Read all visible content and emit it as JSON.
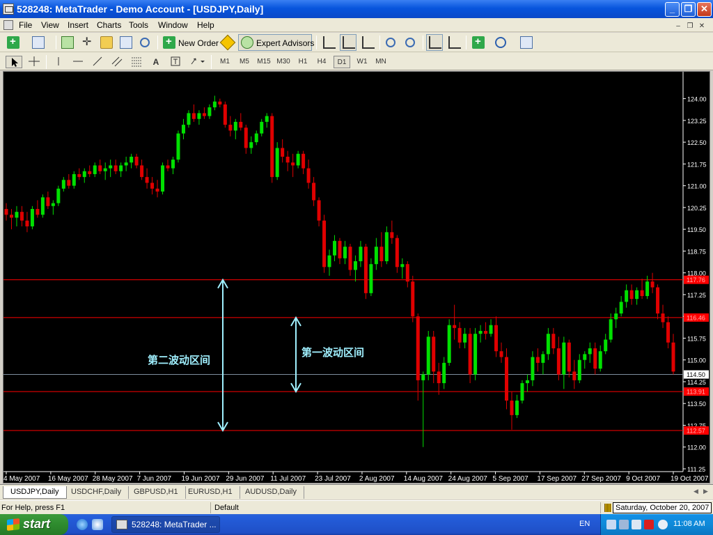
{
  "window": {
    "title": "528248: MetaTrader - Demo Account - [USDJPY,Daily]",
    "controls": [
      "_",
      "❐",
      "✕"
    ]
  },
  "menu": {
    "items": [
      "File",
      "View",
      "Insert",
      "Charts",
      "Tools",
      "Window",
      "Help"
    ],
    "mdi_controls": [
      "–",
      "❐",
      "✕"
    ]
  },
  "toolbar": {
    "new_order_label": "New Order",
    "expert_advisors_label": "Expert Advisors",
    "timeframes": [
      "M1",
      "M5",
      "M15",
      "M30",
      "H1",
      "H4",
      "D1",
      "W1",
      "MN"
    ],
    "active_timeframe": "D1",
    "text_tool_label": "A"
  },
  "chart_data": {
    "type": "candlestick",
    "symbol": "USDJPY",
    "period": "Daily",
    "price_axis": {
      "min": 111.25,
      "max": 124.0,
      "ticks": [
        "124.00",
        "123.25",
        "122.50",
        "121.75",
        "121.00",
        "120.25",
        "119.50",
        "118.75",
        "118.00",
        "117.25",
        "116.50",
        "115.75",
        "115.00",
        "114.25",
        "113.50",
        "112.75",
        "112.00",
        "111.25"
      ],
      "current_price": "114.50"
    },
    "x_labels": [
      "4 May 2007",
      "16 May 2007",
      "28 May 2007",
      "7 Jun 2007",
      "19 Jun 2007",
      "29 Jun 2007",
      "11 Jul 2007",
      "23 Jul 2007",
      "2 Aug 2007",
      "14 Aug 2007",
      "24 Aug 2007",
      "5 Sep 2007",
      "17 Sep 2007",
      "27 Sep 2007",
      "9 Oct 2007",
      "19 Oct 2007"
    ],
    "horizontal_lines": [
      {
        "price": 117.76,
        "label": "117.76",
        "color": "#ff0000"
      },
      {
        "price": 116.46,
        "label": "116.46",
        "color": "#ff0000"
      },
      {
        "price": 113.91,
        "label": "113.91",
        "color": "#ff0000"
      },
      {
        "price": 112.57,
        "label": "112.57",
        "color": "#ff0000"
      },
      {
        "price": 114.5,
        "label": "114.50",
        "color": "#7f8f9f"
      }
    ],
    "annotations": [
      {
        "text": "第二波动区间",
        "arrow_from": 117.76,
        "arrow_to": 112.57
      },
      {
        "text": "第一波动区间",
        "arrow_from": 116.46,
        "arrow_to": 113.91
      }
    ],
    "colors": {
      "background": "#000000",
      "bull": "#00e000",
      "bear": "#e00000",
      "axis_text": "#ffffff",
      "annotation": "#a0f0ff"
    },
    "candles": [
      [
        120.2,
        120.4,
        119.8,
        120.0
      ],
      [
        120.0,
        120.2,
        119.5,
        119.9
      ],
      [
        119.9,
        120.3,
        119.6,
        120.1
      ],
      [
        120.1,
        120.3,
        119.6,
        119.8
      ],
      [
        119.8,
        120.1,
        119.4,
        119.6
      ],
      [
        119.6,
        120.3,
        119.5,
        120.2
      ],
      [
        120.2,
        120.5,
        119.9,
        120.0
      ],
      [
        120.0,
        120.7,
        119.9,
        120.6
      ],
      [
        120.6,
        120.8,
        120.2,
        120.3
      ],
      [
        120.3,
        120.5,
        120.0,
        120.4
      ],
      [
        120.4,
        121.0,
        120.3,
        120.9
      ],
      [
        120.9,
        121.3,
        120.8,
        121.2
      ],
      [
        121.2,
        121.4,
        120.9,
        121.0
      ],
      [
        121.0,
        121.5,
        120.9,
        121.4
      ],
      [
        121.4,
        121.6,
        121.2,
        121.3
      ],
      [
        121.3,
        121.6,
        121.1,
        121.5
      ],
      [
        121.5,
        121.7,
        121.3,
        121.4
      ],
      [
        121.4,
        121.8,
        121.3,
        121.7
      ],
      [
        121.7,
        121.9,
        121.4,
        121.5
      ],
      [
        121.5,
        121.8,
        121.2,
        121.6
      ],
      [
        121.6,
        121.9,
        121.3,
        121.7
      ],
      [
        121.7,
        121.9,
        121.4,
        121.5
      ],
      [
        121.5,
        121.8,
        121.3,
        121.7
      ],
      [
        121.7,
        122.0,
        121.5,
        121.8
      ],
      [
        121.8,
        122.1,
        121.6,
        122.0
      ],
      [
        122.0,
        122.1,
        121.6,
        121.7
      ],
      [
        121.7,
        121.9,
        121.2,
        121.3
      ],
      [
        121.3,
        121.6,
        120.9,
        121.1
      ],
      [
        121.1,
        121.3,
        120.7,
        120.9
      ],
      [
        120.9,
        121.2,
        120.6,
        120.8
      ],
      [
        120.8,
        121.8,
        120.7,
        121.7
      ],
      [
        121.7,
        121.9,
        121.5,
        121.6
      ],
      [
        121.6,
        122.0,
        121.4,
        121.9
      ],
      [
        121.9,
        122.9,
        121.8,
        122.8
      ],
      [
        122.8,
        123.3,
        122.6,
        123.1
      ],
      [
        123.1,
        123.6,
        123.0,
        123.5
      ],
      [
        123.5,
        123.8,
        123.2,
        123.3
      ],
      [
        123.3,
        123.6,
        123.1,
        123.5
      ],
      [
        123.5,
        123.7,
        123.3,
        123.4
      ],
      [
        123.4,
        123.8,
        123.3,
        123.7
      ],
      [
        123.7,
        124.1,
        123.6,
        123.9
      ],
      [
        123.9,
        124.0,
        123.7,
        123.8
      ],
      [
        123.8,
        123.9,
        123.0,
        123.1
      ],
      [
        123.1,
        123.4,
        122.7,
        122.9
      ],
      [
        122.9,
        123.3,
        122.6,
        123.2
      ],
      [
        123.2,
        123.5,
        122.9,
        123.0
      ],
      [
        123.0,
        123.1,
        122.1,
        122.3
      ],
      [
        122.3,
        122.7,
        122.1,
        122.5
      ],
      [
        122.5,
        122.9,
        122.4,
        122.8
      ],
      [
        122.8,
        123.3,
        122.7,
        123.2
      ],
      [
        123.2,
        123.5,
        123.0,
        123.4
      ],
      [
        123.4,
        123.5,
        121.1,
        121.3
      ],
      [
        121.3,
        122.5,
        121.2,
        122.3
      ],
      [
        122.3,
        122.6,
        121.8,
        122.0
      ],
      [
        122.0,
        122.2,
        121.5,
        121.8
      ],
      [
        121.8,
        122.1,
        121.3,
        121.7
      ],
      [
        121.7,
        122.2,
        121.6,
        122.1
      ],
      [
        122.1,
        122.2,
        121.4,
        121.6
      ],
      [
        121.6,
        121.9,
        120.9,
        121.1
      ],
      [
        121.1,
        121.3,
        120.3,
        120.5
      ],
      [
        120.5,
        120.6,
        119.6,
        119.8
      ],
      [
        119.8,
        120.0,
        118.0,
        118.2
      ],
      [
        118.2,
        118.8,
        117.9,
        118.6
      ],
      [
        118.6,
        119.3,
        118.4,
        119.1
      ],
      [
        119.1,
        119.2,
        118.3,
        118.5
      ],
      [
        118.5,
        119.1,
        118.3,
        118.9
      ],
      [
        118.9,
        119.0,
        117.9,
        118.1
      ],
      [
        118.1,
        118.6,
        117.7,
        118.4
      ],
      [
        118.4,
        119.1,
        118.2,
        118.9
      ],
      [
        118.9,
        119.0,
        117.1,
        117.3
      ],
      [
        117.3,
        118.5,
        117.2,
        118.3
      ],
      [
        118.3,
        119.2,
        118.1,
        118.9
      ],
      [
        118.9,
        119.4,
        118.2,
        118.4
      ],
      [
        118.4,
        119.6,
        118.3,
        119.4
      ],
      [
        119.4,
        119.8,
        119.0,
        119.2
      ],
      [
        119.2,
        119.3,
        118.0,
        118.2
      ],
      [
        118.2,
        118.5,
        117.8,
        118.3
      ],
      [
        118.3,
        118.4,
        117.5,
        117.7
      ],
      [
        117.7,
        117.9,
        116.3,
        116.5
      ],
      [
        116.5,
        116.6,
        113.6,
        114.3
      ],
      [
        114.3,
        114.6,
        112.0,
        114.5
      ],
      [
        114.5,
        116.0,
        114.3,
        115.8
      ],
      [
        115.8,
        116.0,
        114.2,
        114.6
      ],
      [
        114.6,
        114.9,
        113.8,
        114.2
      ],
      [
        114.2,
        115.1,
        114.0,
        114.9
      ],
      [
        114.9,
        116.4,
        114.8,
        116.2
      ],
      [
        116.2,
        116.9,
        115.7,
        116.1
      ],
      [
        116.1,
        116.3,
        115.4,
        115.6
      ],
      [
        115.6,
        116.1,
        115.4,
        115.9
      ],
      [
        115.9,
        116.1,
        114.2,
        114.5
      ],
      [
        114.5,
        116.1,
        114.3,
        115.9
      ],
      [
        115.9,
        116.2,
        115.6,
        116.0
      ],
      [
        116.0,
        116.3,
        115.7,
        115.9
      ],
      [
        115.9,
        116.4,
        115.8,
        116.2
      ],
      [
        116.2,
        116.5,
        115.1,
        115.3
      ],
      [
        115.3,
        115.6,
        114.9,
        115.1
      ],
      [
        115.1,
        115.4,
        113.3,
        113.6
      ],
      [
        113.6,
        113.9,
        112.6,
        113.1
      ],
      [
        113.1,
        113.8,
        113.0,
        113.6
      ],
      [
        113.6,
        114.3,
        113.5,
        114.2
      ],
      [
        114.2,
        114.5,
        113.9,
        114.3
      ],
      [
        114.3,
        115.3,
        114.1,
        115.1
      ],
      [
        115.1,
        115.4,
        114.6,
        114.9
      ],
      [
        114.9,
        115.3,
        114.5,
        115.2
      ],
      [
        115.2,
        116.1,
        115.0,
        115.9
      ],
      [
        115.9,
        116.1,
        115.2,
        115.4
      ],
      [
        115.4,
        115.8,
        114.3,
        114.5
      ],
      [
        114.5,
        115.8,
        114.0,
        115.6
      ],
      [
        115.6,
        115.7,
        114.4,
        114.6
      ],
      [
        114.6,
        115.0,
        114.0,
        114.3
      ],
      [
        114.3,
        115.2,
        114.2,
        115.0
      ],
      [
        115.0,
        115.3,
        114.7,
        115.2
      ],
      [
        115.2,
        115.6,
        114.9,
        115.4
      ],
      [
        115.4,
        115.6,
        114.5,
        114.7
      ],
      [
        114.7,
        115.5,
        114.6,
        115.3
      ],
      [
        115.3,
        115.9,
        115.2,
        115.7
      ],
      [
        115.7,
        116.6,
        115.6,
        116.4
      ],
      [
        116.4,
        116.8,
        116.1,
        116.6
      ],
      [
        116.6,
        117.2,
        116.5,
        117.0
      ],
      [
        117.0,
        117.6,
        116.8,
        117.4
      ],
      [
        117.4,
        117.6,
        116.9,
        117.1
      ],
      [
        117.1,
        117.5,
        116.9,
        117.4
      ],
      [
        117.4,
        117.8,
        117.1,
        117.2
      ],
      [
        117.2,
        117.9,
        117.1,
        117.7
      ],
      [
        117.7,
        118.0,
        117.3,
        117.5
      ],
      [
        117.5,
        117.6,
        116.4,
        116.6
      ],
      [
        116.6,
        116.9,
        116.1,
        116.3
      ],
      [
        116.3,
        116.5,
        115.4,
        115.6
      ],
      [
        115.6,
        115.9,
        114.5,
        114.6
      ]
    ]
  },
  "chart_tabs": [
    "USDJPY,Daily",
    "USDCHF,Daily",
    "GBPUSD,H1",
    "EURUSD,H1",
    "AUDUSD,Daily"
  ],
  "active_tab": "USDJPY,Daily",
  "status": {
    "help": "For Help, press F1",
    "profile": "Default",
    "date": "Saturday, October 20, 2007"
  },
  "taskbar": {
    "start_label": "start",
    "task_label": "528248: MetaTrader ...",
    "language": "EN",
    "clock": "11:08 AM"
  }
}
